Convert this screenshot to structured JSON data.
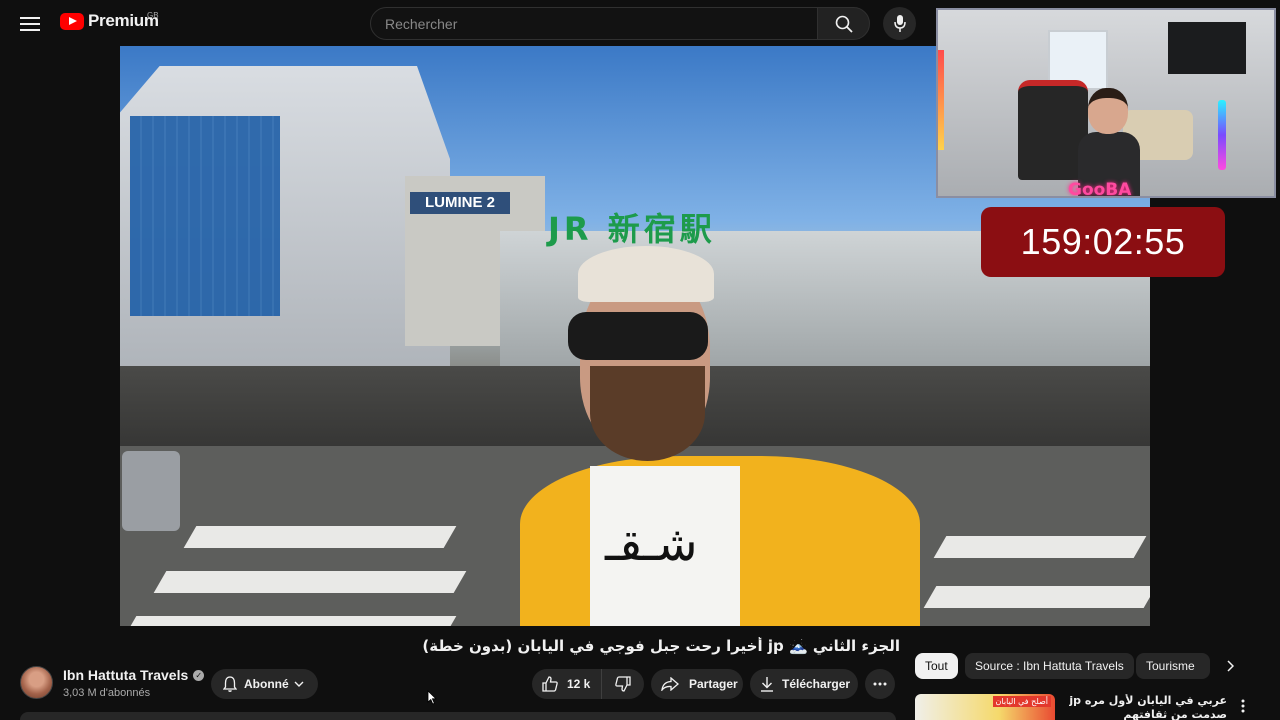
{
  "app": {
    "brand_label": "Premium",
    "region": "GB"
  },
  "search": {
    "placeholder": "Rechercher"
  },
  "icons": {
    "menu": "hamburger-icon",
    "search": "search-icon",
    "mic": "mic-icon",
    "bell": "bell-icon",
    "like": "thumbs-up-icon",
    "dislike": "thumbs-down-icon",
    "share": "share-icon",
    "download": "download-icon",
    "more": "more-horizontal-icon"
  },
  "colors": {
    "brand_red": "#ff0000",
    "background": "#0f0f0f",
    "timer_bg": "#8b0e12",
    "chip_active_bg": "#f1f1f1"
  },
  "video": {
    "overlay_timer": "159:02:55",
    "overlay_cam_name": "GooBA"
  },
  "video_info": {
    "title": "الجزء الثاني 🗻 jp أخيرا رحت جبل فوجي في اليابان (بدون خطة)"
  },
  "channel": {
    "name": "Ibn Hattuta Travels",
    "subscribers": "3,03 M d'abonnés",
    "subscribed_label": "Abonné"
  },
  "actions": {
    "like_count": "12 k",
    "share_label": "Partager",
    "download_label": "Télécharger"
  },
  "chips": [
    {
      "label": "Tout",
      "active": true
    },
    {
      "label": "Source : Ibn Hattuta Travels",
      "active": false
    },
    {
      "label": "Tourisme",
      "active": false
    }
  ],
  "recommendations": [
    {
      "title": "عربي في اليابان لأول مره jp صدمت من ثقافتهم",
      "thumb_label": "أصلح في اليابان"
    }
  ]
}
